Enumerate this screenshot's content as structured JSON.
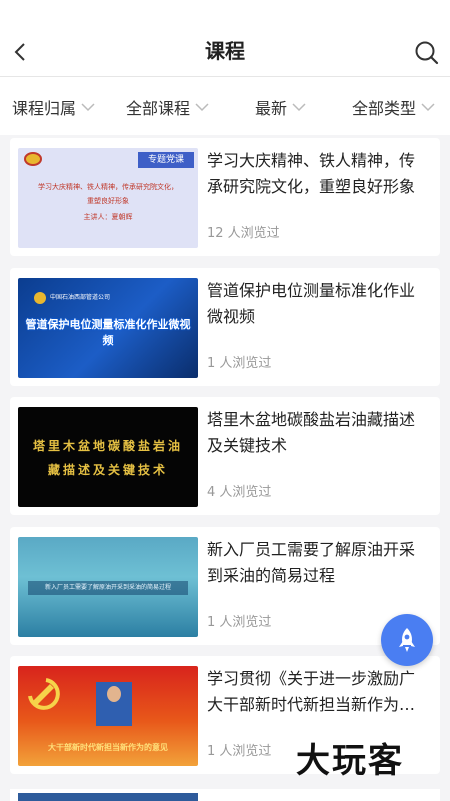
{
  "header": {
    "title": "课程"
  },
  "filters": [
    {
      "label": "课程归属"
    },
    {
      "label": "全部课程"
    },
    {
      "label": "最新"
    },
    {
      "label": "全部类型"
    }
  ],
  "courses": [
    {
      "title": "学习大庆精神、铁人精神，传承研究院文化，重塑良好形象",
      "views": "12 人浏览过",
      "thumb": {
        "badge": "专题党课",
        "line1": "学习大庆精神、铁人精神，传承研究院文化，",
        "line2": "重塑良好形象",
        "line3": "主讲人：夏朝辉"
      }
    },
    {
      "title": "管道保护电位测量标准化作业微视频",
      "views": "1 人浏览过",
      "thumb": {
        "org": "中国石油西部管道公司",
        "text": "管道保护电位测量标准化作业微视频"
      }
    },
    {
      "title": "塔里木盆地碳酸盐岩油藏描述及关键技术",
      "views": "4 人浏览过",
      "thumb": {
        "line1": "塔里木盆地碳酸盐岩油",
        "line2": "藏描述及关键技术"
      }
    },
    {
      "title": "新入厂员工需要了解原油开采到采油的简易过程",
      "views": "1 人浏览过",
      "thumb": {
        "text": "新入厂员工需要了解原油开采到采油的简易过程"
      }
    },
    {
      "title": "学习贯彻《关于进一步激励广大干部新时代新担当新作为的意见》",
      "views": "1 人浏览过",
      "thumb": {
        "text": "大干部新时代新担当新作为的意见"
      }
    }
  ],
  "watermark": "大玩客",
  "colors": {
    "accent": "#4a7ef2",
    "muted": "#999999",
    "background": "#f4f4f6"
  }
}
